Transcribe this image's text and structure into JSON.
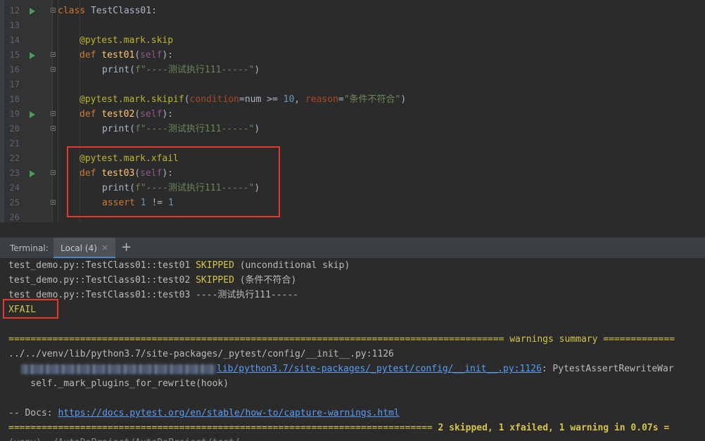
{
  "editor": {
    "lines": [
      {
        "n": "12",
        "code": "class TestClass01:"
      },
      {
        "n": "13",
        "code": ""
      },
      {
        "n": "14",
        "code": "@pytest.mark.skip"
      },
      {
        "n": "15",
        "code": "def test01(self):"
      },
      {
        "n": "16",
        "code": "print(f\"----测试执行111-----\")"
      },
      {
        "n": "17",
        "code": ""
      },
      {
        "n": "18",
        "code": "@pytest.mark.skipif(condition=num >= 10, reason=\"条件不符合\")"
      },
      {
        "n": "19",
        "code": "def test02(self):"
      },
      {
        "n": "20",
        "code": "print(f\"----测试执行111-----\")"
      },
      {
        "n": "21",
        "code": ""
      },
      {
        "n": "22",
        "code": "@pytest.mark.xfail"
      },
      {
        "n": "23",
        "code": "def test03(self):"
      },
      {
        "n": "24",
        "code": "print(f\"----测试执行111-----\")"
      },
      {
        "n": "25",
        "code": "assert 1 != 1"
      },
      {
        "n": "26",
        "code": ""
      }
    ]
  },
  "terminal": {
    "title": "Terminal:",
    "tab_label": "Local (4)",
    "tab_close": "×",
    "add": "+",
    "out1_prefix": "test_demo.py::TestClass01::test01 ",
    "out1_status": "SKIPPED",
    "out1_suffix": " (unconditional skip)",
    "out2_prefix": "test_demo.py::TestClass01::test02 ",
    "out2_status": "SKIPPED",
    "out2_suffix": " (条件不符合)",
    "out3": "test_demo.py::TestClass01::test03 ----测试执行111-----",
    "out4": "XFAIL",
    "warn_header": "========================================================================================== warnings summary =============",
    "warn_path": "../../venv/lib/python3.7/site-packages/_pytest/config/__init__.py:1126",
    "warn_link_tail": "lib/python3.7/site-packages/_pytest/config/__init__.py:1126",
    "warn_msg": ": PytestAssertRewriteWar",
    "warn_code": "    self._mark_plugins_for_rewrite(hook)",
    "docs_label": "-- Docs: ",
    "docs_link": "https://docs.pytest.org/en/stable/how-to/capture-warnings.html",
    "summary_eq": "============================================================================= ",
    "summary_text": "2 skipped, 1 xfailed, 1 warning in 0.07s =",
    "prompt_partial": "(venv) ~/AutoDoProject/AutoDoProject/test/..."
  },
  "colors": {
    "keyword": "#cc7832",
    "decorator": "#bbb529",
    "function": "#ffc66d",
    "string": "#6a8759",
    "number": "#6897bb",
    "highlight_box": "#e8362b"
  }
}
